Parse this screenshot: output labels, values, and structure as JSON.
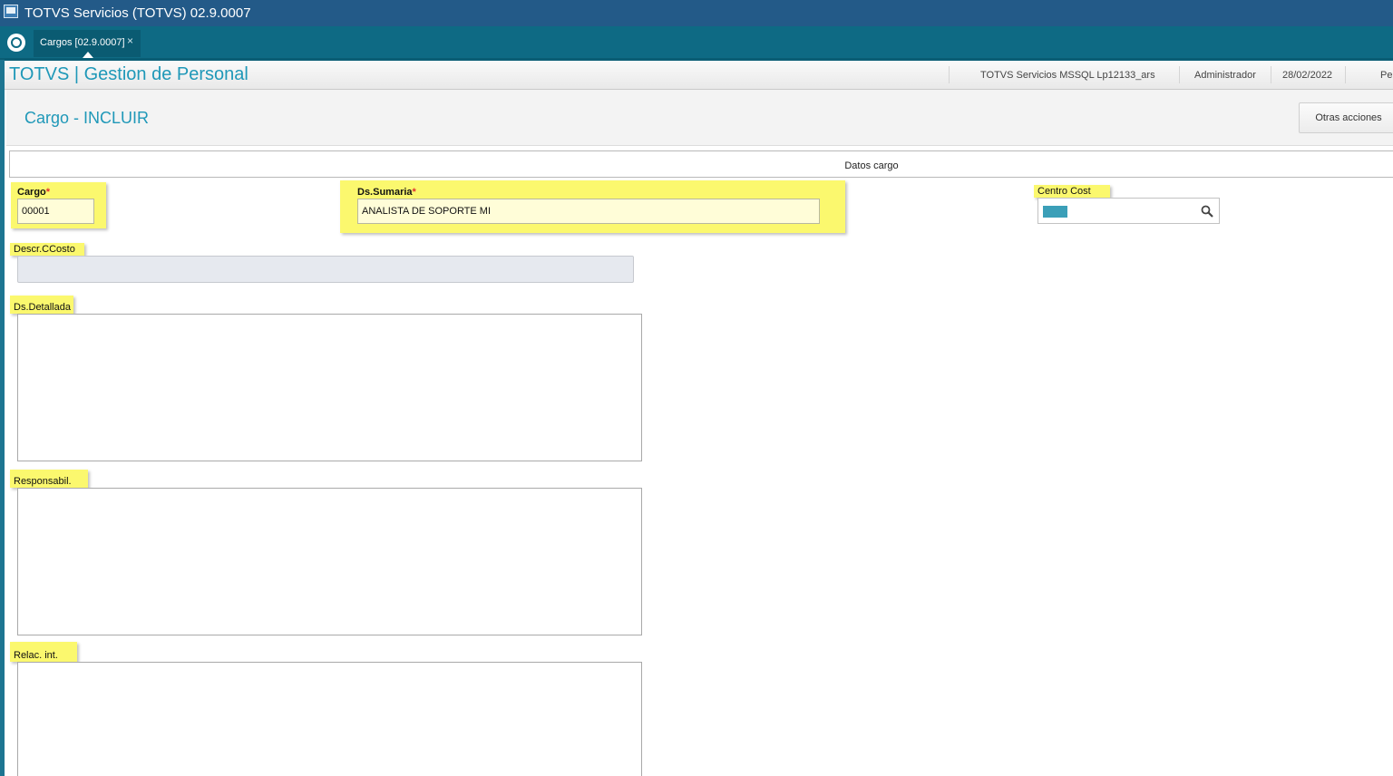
{
  "window": {
    "title": "TOTVS Servicios (TOTVS) 02.9.0007"
  },
  "tabs": [
    {
      "label": "Cargos [02.9.0007]",
      "close_glyph": "×"
    }
  ],
  "header": {
    "module_title": "TOTVS | Gestion de Personal",
    "environment": "TOTVS Servicios MSSQL Lp12133_ars",
    "user": "Administrador",
    "date": "28/02/2022",
    "truncated_info": "Pe"
  },
  "page": {
    "title": "Cargo - INCLUIR",
    "other_actions_label": "Otras acciones"
  },
  "folder": {
    "label": "Datos cargo"
  },
  "fields": {
    "cargo": {
      "label": "Cargo",
      "required_mark": "*",
      "value": "00001"
    },
    "ds_sumaria": {
      "label": "Ds.Sumaria",
      "required_mark": "*",
      "value": "ANALISTA DE SOPORTE MI"
    },
    "centro_cost": {
      "label": "Centro Cost",
      "value": ""
    },
    "descr_ccosto": {
      "label": "Descr.CCosto",
      "value": ""
    },
    "ds_detallada": {
      "label": "Ds.Detallada",
      "value": ""
    },
    "responsabil": {
      "label": "Responsabil.",
      "value": ""
    },
    "relac_int": {
      "label": "Relac. int.",
      "value": ""
    }
  },
  "colors": {
    "title_bar": "#235a88",
    "tab_strip": "#0e6a84",
    "accent_text": "#1f98b8",
    "field_highlight": "#fbf86e",
    "required": "#e03030"
  },
  "icons": {
    "app": "window-app-icon",
    "logo": "totvs-logo-icon",
    "lookup": "search-icon"
  }
}
